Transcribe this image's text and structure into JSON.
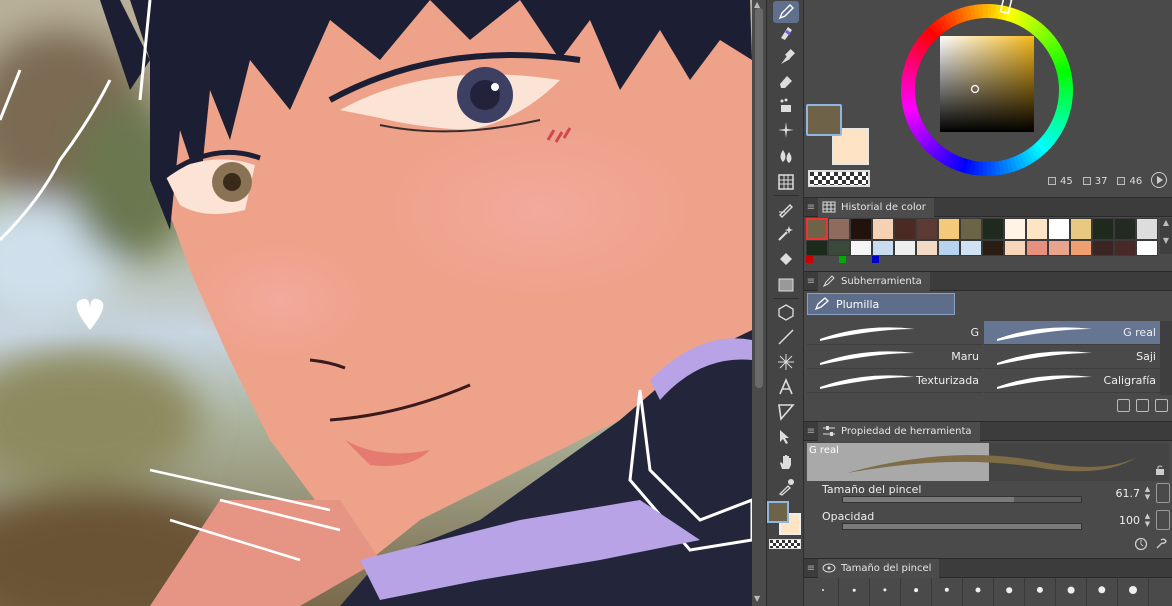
{
  "colors": {
    "main": "#6e6348",
    "sub": "#fde4c4",
    "accent": "#5f6f8c"
  },
  "color_wheel": {
    "h_value": "45",
    "s_value": "37",
    "v_value": "46"
  },
  "color_history": {
    "title": "Historial de color",
    "row1": [
      "#6e6348",
      "#8e6b5c",
      "#22120c",
      "#f6d1b4",
      "#4a2a22",
      "#5e3a34",
      "#f4c97a",
      "#6c6446",
      "#1e2a1e",
      "#fff3e6",
      "#fde4c4",
      "#ffffff",
      "#e9c982",
      "#1f2a1c",
      "#222a22",
      "#dddddd"
    ],
    "row2": [
      "#1c2a1c",
      "#3b4b3b",
      "#f5f5f5",
      "#c9dbef",
      "#eeeeee",
      "#f2d9c4",
      "#b5d3ef",
      "#cfe3f5",
      "#2a1e14",
      "#f7d5b8",
      "#e89080",
      "#e8a48c",
      "#f0a070",
      "#3a2424",
      "#4a2a28",
      "#ffffff"
    ]
  },
  "subtool": {
    "title": "Subherramienta",
    "group_label": "Plumilla",
    "brushes": [
      {
        "label": "G"
      },
      {
        "label": "G real"
      },
      {
        "label": "Maru"
      },
      {
        "label": "Saji"
      },
      {
        "label": "Texturizada"
      },
      {
        "label": "Caligrafía"
      }
    ]
  },
  "tool_property": {
    "title": "Propiedad de herramienta",
    "preview_label": "G real",
    "brush_size_label": "Tamaño del pincel",
    "brush_size_value": "61.7",
    "brush_size_fraction": 0.72,
    "opacity_label": "Opacidad",
    "opacity_value": "100",
    "opacity_fraction": 1.0
  },
  "brush_size_panel": {
    "title": "Tamaño del pincel",
    "dot_count": 11
  },
  "tools": [
    "pen-icon",
    "marker-icon",
    "airbrush-icon",
    "eraser-icon",
    "decoration-icon",
    "sparkle-icon",
    "blend-icon",
    "grid-icon",
    "correct-line-icon",
    "auto-select-icon",
    "fill-icon",
    "gradient-icon",
    "3d-icon",
    "figure-icon",
    "frame-icon",
    "text-icon",
    "balloon-icon",
    "object-select-icon",
    "hand-icon",
    "eyedropper-icon"
  ]
}
